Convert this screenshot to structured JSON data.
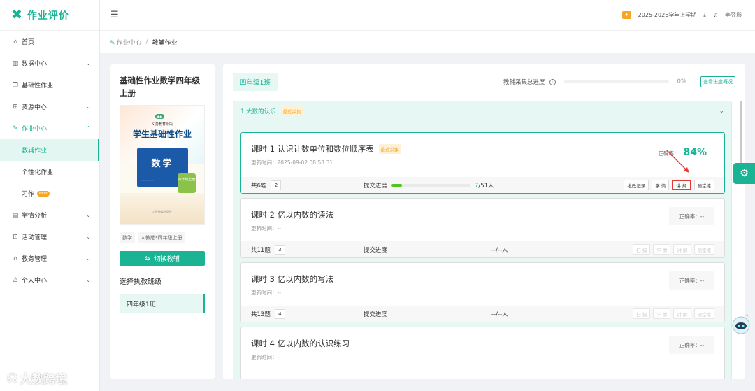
{
  "app": {
    "name": "作业评价"
  },
  "sidebar": {
    "items": [
      {
        "label": "首页",
        "icon": "home-icon"
      },
      {
        "label": "数据中心",
        "icon": "chart-icon"
      },
      {
        "label": "基础性作业",
        "icon": "copy-icon"
      },
      {
        "label": "资源中心",
        "icon": "grid-icon"
      },
      {
        "label": "作业中心",
        "icon": "edit-icon"
      },
      {
        "label": "学情分析",
        "icon": "analysis-icon"
      },
      {
        "label": "活动管理",
        "icon": "gift-icon"
      },
      {
        "label": "教务管理",
        "icon": "building-icon"
      },
      {
        "label": "个人中心",
        "icon": "user-icon"
      }
    ],
    "subitems": [
      {
        "label": "教辅作业"
      },
      {
        "label": "个性化作业"
      },
      {
        "label": "习作",
        "badge": "NEW"
      }
    ]
  },
  "topbar": {
    "semester": "2025-2026学年上学期",
    "user": "李翌彤"
  },
  "breadcrumb": {
    "home": "作业中心",
    "separator": "/",
    "current": "教辅作业"
  },
  "book": {
    "title": "基础性作业数学四年级上册",
    "cover": {
      "top_text": "义务教育阶段",
      "main_title": "学生基础性作业",
      "subject": "数学",
      "grade_badge": "四年级上册",
      "publisher": "人民教育出版社"
    },
    "tags": [
      "数学",
      "人教版*四年级上册"
    ],
    "switch_label": "切换教辅",
    "class_heading": "选择执教班级",
    "selected_class": "四年级1班"
  },
  "main": {
    "class_tab": "四年级1班",
    "total_progress_label": "教辅采集总进度",
    "total_progress_pct": "0%",
    "view_progress_btn": "查看进度概况",
    "unit": {
      "title": "1 大数的认识",
      "tag": "最近采集"
    },
    "lessons": [
      {
        "title": "课时 1   认识计数单位和数位顺序表",
        "tag": "最近采集",
        "time": "更新时间：2025-09-02 08:53:31",
        "accuracy_label": "正确率：",
        "accuracy": "84%",
        "count": "共6题",
        "count_num": "2",
        "submit_label": "提交进度",
        "submit_done": "7",
        "submit_total": "/51人",
        "submit_fraction": 0.137,
        "actions": [
          "批改记录",
          "学 情",
          "讲 解",
          "随堂练"
        ]
      },
      {
        "title": "课时 2   亿以内数的读法",
        "time": "更新时间：--",
        "accuracy_text": "正确率：--",
        "count": "共11题",
        "count_num": "3",
        "submit_label": "提交进度",
        "submit_text": "--/--人",
        "actions": [
          "扫 描",
          "学 情",
          "讲 解",
          "随堂练"
        ]
      },
      {
        "title": "课时 3   亿以内数的写法",
        "time": "更新时间：--",
        "accuracy_text": "正确率：--",
        "count": "共13题",
        "count_num": "4",
        "submit_label": "提交进度",
        "submit_text": "--/--人",
        "actions": [
          "扫 描",
          "学 情",
          "讲 解",
          "随堂练"
        ]
      },
      {
        "title": "课时 4   亿以内数的认识练习",
        "time": "更新时间：--",
        "accuracy_text": "正确率：--"
      }
    ]
  },
  "watermark": "大数跨境",
  "colors": {
    "accent": "#1ab394",
    "highlight": "#e53935",
    "tag": "#f5a623"
  }
}
